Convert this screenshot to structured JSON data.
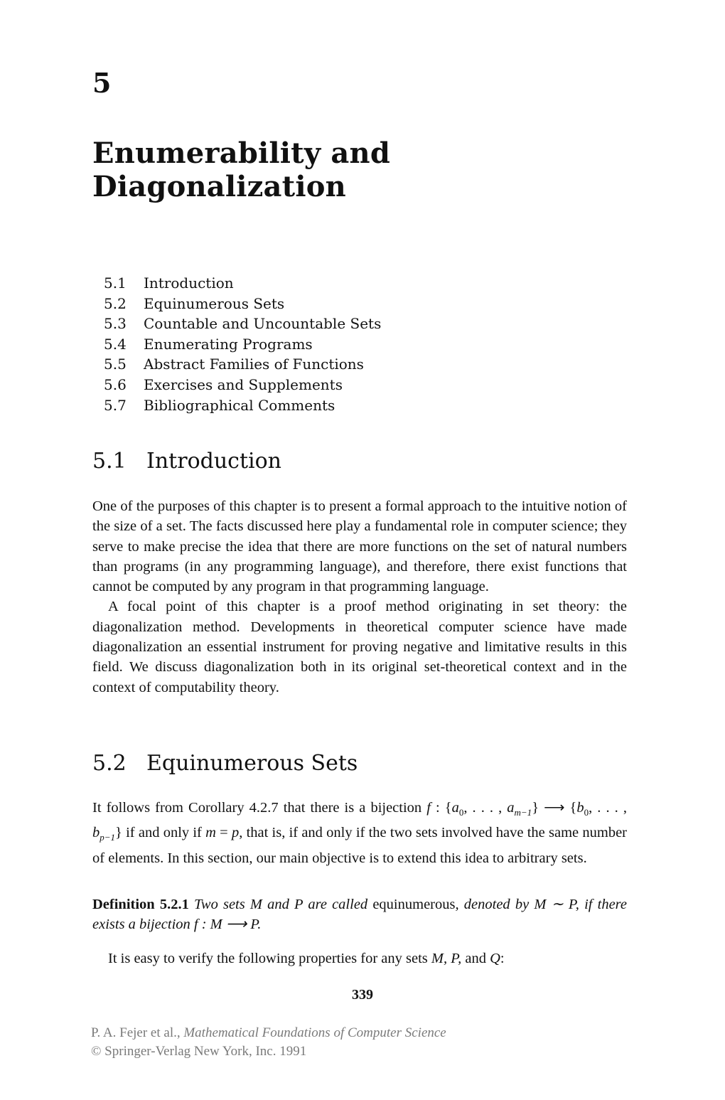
{
  "chapter": {
    "number": "5",
    "title_line1": "Enumerability and",
    "title_line2": "Diagonalization"
  },
  "toc": [
    {
      "num": "5.1",
      "title": "Introduction"
    },
    {
      "num": "5.2",
      "title": "Equinumerous Sets"
    },
    {
      "num": "5.3",
      "title": "Countable and Uncountable Sets"
    },
    {
      "num": "5.4",
      "title": "Enumerating Programs"
    },
    {
      "num": "5.5",
      "title": "Abstract Families of Functions"
    },
    {
      "num": "5.6",
      "title": "Exercises and Supplements"
    },
    {
      "num": "5.7",
      "title": "Bibliographical Comments"
    }
  ],
  "sections": [
    {
      "num": "5.1",
      "title": "Introduction",
      "paragraphs": [
        "One of the purposes of this chapter is to present a formal approach to the intuitive notion of the size of a set. The facts discussed here play a fundamental role in computer science; they serve to make precise the idea that there are more functions on the set of natural numbers than programs (in any programming language), and therefore, there exist functions that cannot be computed by any program in that programming language.",
        "A focal point of this chapter is a proof method originating in set theory: the diagonalization method. Developments in theoretical computer science have made diagonalization an essential instrument for proving negative and limitative results in this field. We discuss diagonalization both in its original set-theoretical context and in the context of computability theory."
      ]
    },
    {
      "num": "5.2",
      "title": "Equinumerous Sets",
      "intro": {
        "t1": "It follows from Corollary 4.2.7 that there is a bijection ",
        "f": "f",
        "t2": " : {",
        "a0": "a",
        "sub0": "0",
        "t3": ", . . . , ",
        "am": "a",
        "subm": "m−1",
        "t4": "} ⟶ {",
        "b0": "b",
        "subb0": "0",
        "t5": ", . . . , ",
        "bp": "b",
        "subp": "p−1",
        "t6": "} if and only if ",
        "m": "m",
        "t7": " = ",
        "p": "p",
        "t8": ", that is, if and only if the two sets involved have the same number of elements. In this section, our main objective is to extend this idea to arbitrary sets."
      },
      "definition": {
        "label": "Definition 5.2.1",
        "t1": " Two sets M and P are called ",
        "term": "equinumerous",
        "t2": ", denoted by M ∼ P, if there exists a bijection f : M ⟶ P."
      },
      "after": {
        "t1": "It is easy to verify the following properties for any sets ",
        "vars": "M, P,",
        "t2": " and ",
        "q": "Q",
        "t3": ":"
      }
    }
  ],
  "page_number": "339",
  "footer": {
    "line1_plain": "P. A. Fejer et al., ",
    "line1_italic": "Mathematical Foundations of Computer Science",
    "line2": "© Springer-Verlag New York, Inc. 1991"
  }
}
